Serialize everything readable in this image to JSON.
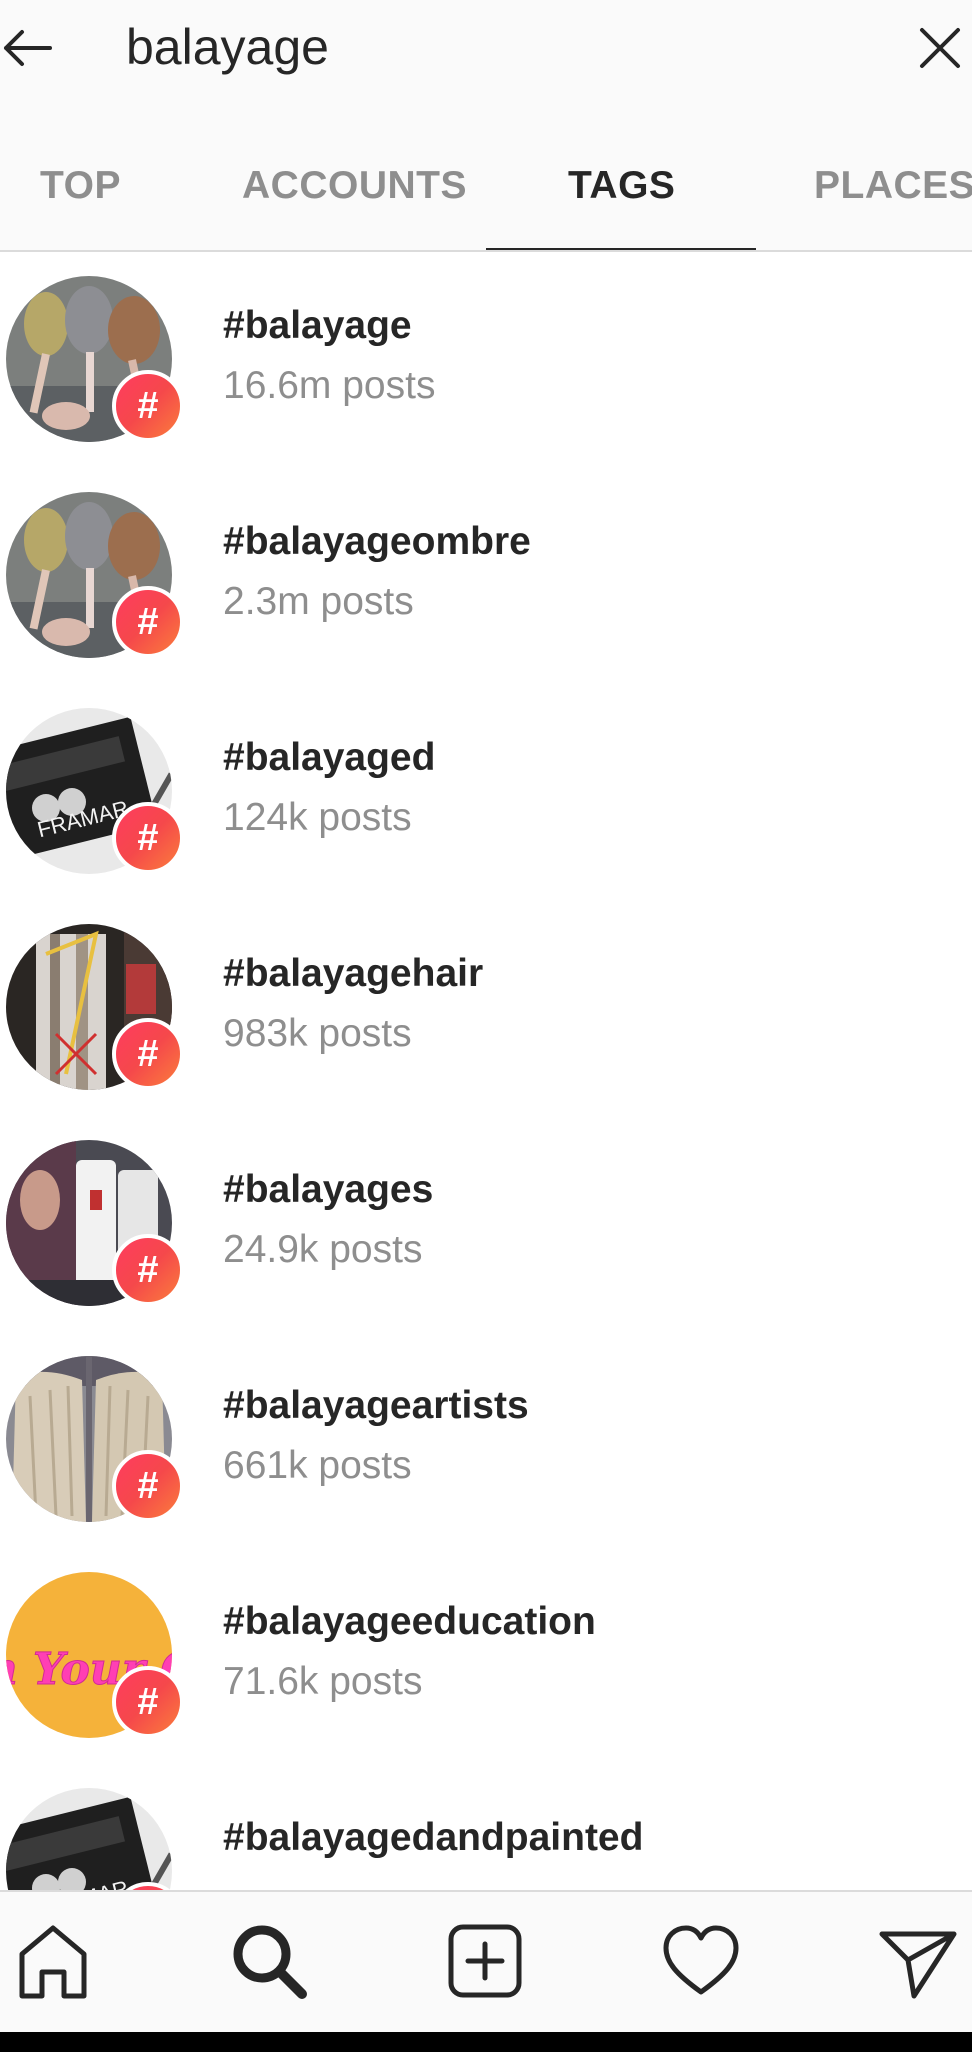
{
  "search": {
    "query": "balayage"
  },
  "tabs": [
    {
      "label": "TOP",
      "active": false
    },
    {
      "label": "ACCOUNTS",
      "active": false
    },
    {
      "label": "TAGS",
      "active": true
    },
    {
      "label": "PLACES",
      "active": false
    }
  ],
  "results": [
    {
      "tag": "#balayage",
      "count": "16.6m posts",
      "thumbnail": "hair-brushes-photo"
    },
    {
      "tag": "#balayageombre",
      "count": "2.3m posts",
      "thumbnail": "hair-brushes-photo"
    },
    {
      "tag": "#balayaged",
      "count": "124k posts",
      "thumbnail": "framar-foil-box-photo",
      "thumbnail_text": "FRAMAR"
    },
    {
      "tag": "#balayagehair",
      "count": "983k posts",
      "thumbnail": "foil-hair-coloring-photo"
    },
    {
      "tag": "#balayages",
      "count": "24.9k posts",
      "thumbnail": "salon-product-bottles-photo"
    },
    {
      "tag": "#balayageartists",
      "count": "661k posts",
      "thumbnail": "blonde-hair-mirror-photo"
    },
    {
      "tag": "#balayageeducation",
      "count": "71.6k posts",
      "thumbnail": "own-your-own-graphic",
      "thumbnail_text": "Own Your Own"
    },
    {
      "tag": "#balayagedandpainted",
      "count": "",
      "thumbnail": "framar-foil-box-photo",
      "thumbnail_text": "FRAMAR"
    }
  ],
  "badge_symbol": "#",
  "bottom_nav": [
    {
      "icon": "home-icon"
    },
    {
      "icon": "search-icon",
      "active": true
    },
    {
      "icon": "new-post-icon"
    },
    {
      "icon": "heart-icon"
    },
    {
      "icon": "direct-message-icon"
    }
  ],
  "colors": {
    "primary_text": "#262626",
    "secondary_text": "#8e8e8e",
    "divider": "#dbdbdb",
    "badge_gradient_start": "#ff3c5f",
    "badge_gradient_end": "#fb7d3c"
  }
}
